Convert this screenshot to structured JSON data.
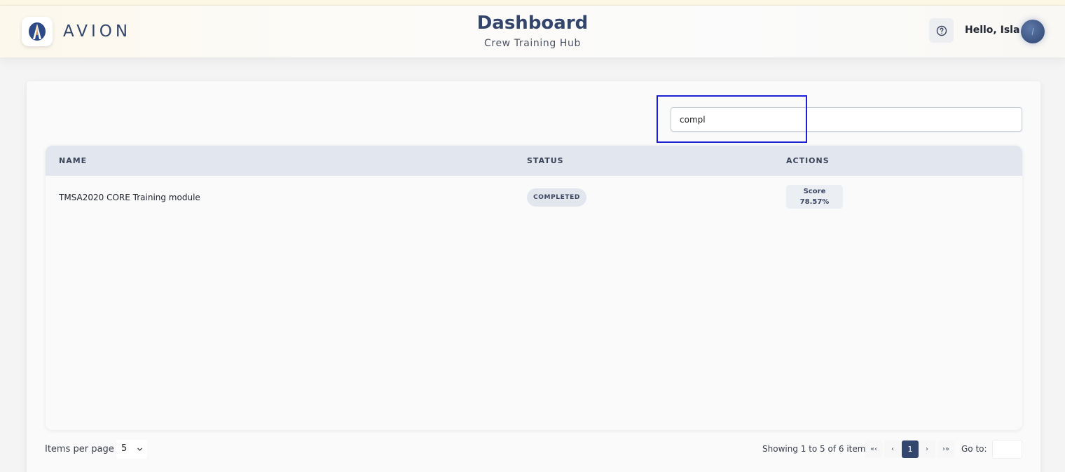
{
  "header": {
    "brand": "AVION",
    "title": "Dashboard",
    "subtitle": "Crew Training Hub",
    "greeting": "Hello, Isla"
  },
  "search": {
    "value": "compl",
    "placeholder": ""
  },
  "table": {
    "columns": [
      "NAME",
      "STATUS",
      "ACTIONS"
    ],
    "rows": [
      {
        "name": "TMSA2020 CORE Training module",
        "status": "COMPLETED",
        "score_label": "Score",
        "score_value": "78.57%"
      }
    ]
  },
  "pagination": {
    "items_per_page_label": "Items per page",
    "items_per_page_value": "5",
    "showing": "Showing 1 to 5 of 6 items",
    "first": "«‹",
    "prev": "‹",
    "current_page": "1",
    "next": "›",
    "last": "›»",
    "goto_label": "Go to:",
    "goto_value": ""
  },
  "colors": {
    "brand": "#33456b",
    "highlight": "#1d1fd6",
    "active_page": "#33476e"
  },
  "icons": {
    "logo": "avion-logo-icon",
    "help": "question-circle-icon",
    "avatar": "user-avatar",
    "select": "chevron-down-icon"
  }
}
